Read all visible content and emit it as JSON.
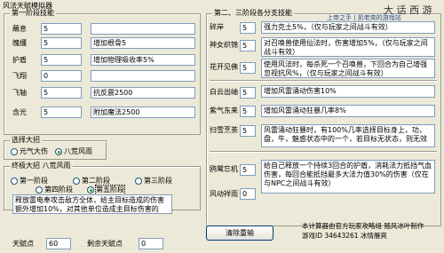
{
  "app": {
    "title": "风法天赋模拟器"
  },
  "tier1": {
    "legend": "第一阶段技能",
    "rows": [
      {
        "label": "蘸息",
        "value": "5",
        "desc": ""
      },
      {
        "label": "魄缰",
        "value": "5",
        "desc": "增加根骨5"
      },
      {
        "label": "护盾",
        "value": "5",
        "desc": "增加物理吸收率5%"
      },
      {
        "label": "飞翔",
        "value": "0",
        "desc": ""
      },
      {
        "label": "飞轴",
        "value": "5",
        "desc": "抗反震2500"
      },
      {
        "label": "含光",
        "value": "5",
        "desc": "附加魔法2500"
      }
    ]
  },
  "tier23": {
    "legend": "第二、三阶段各分支技能",
    "watermark": "上帝之手 | 凯老奕的游戏站",
    "brand": "大 话 西 游",
    "rows": [
      {
        "label": "碎岸",
        "value": "5",
        "desc": "强力克土5%，（仅与玩家之间战斗有效）"
      },
      {
        "label": "神女织锦",
        "value": "5",
        "desc": "对召唤兽使用仙法时，伤害增加5%，（仅与玩家之间战斗有效）"
      },
      {
        "label": "花开见佛",
        "value": "5",
        "desc": "使用风法时，每杀死一个召唤兽，下回合为自己增强忽视抗风%，（仅与玩家之间战斗有效）"
      },
      {
        "label": "白云出岫",
        "value": "5",
        "desc": "增加风雷涌动伤害10%"
      },
      {
        "label": "紫气东来",
        "value": "5",
        "desc": "增加风雷涌动狂暴几率8%"
      },
      {
        "label": "扫雪烹茶",
        "value": "5",
        "desc": "风雷涌动狂暴时，有100%几率选择目标身上，功，盘，牛，魅惑状态中的一个，若目标无状态，则无效"
      },
      {
        "label": "鸥鹭忘机",
        "value": "5",
        "desc": "给自己释放一个持续3回合的护盾，消耗法力抵挡气血伤害，每回合能抵挡最多大法力值30%的伤害（仅在与NPC之间战斗有效）"
      },
      {
        "label": "风动祥雨",
        "value": "0",
        "desc": ""
      }
    ]
  },
  "choose_ultimate": {
    "legend": "选择大招",
    "options": [
      "元气大伤",
      "八荒风雨"
    ],
    "selected": 1
  },
  "ultimate_stage": {
    "legend": "终极大招 八荒风雨",
    "options": [
      "第一阶段",
      "第二阶段",
      "第三阶段",
      "第四阶段",
      "第五阶段"
    ],
    "selected": 4,
    "desc": "释放雷电奉攻击敌方全体，给主目标造成的伤害额外增加10%，对其他单位造成主目标伤害的5%-55%"
  },
  "footer": {
    "points_label": "天赋点",
    "points_value": "60",
    "remaining_label": "剩余天赋点",
    "remaining_value": "0",
    "reset_label": "清除重输",
    "credit_line1": "本计算器由官方玩家攻略组 随风冰叶制作",
    "credit_line2": "游戏ID 34643261 冰情雁爽"
  }
}
